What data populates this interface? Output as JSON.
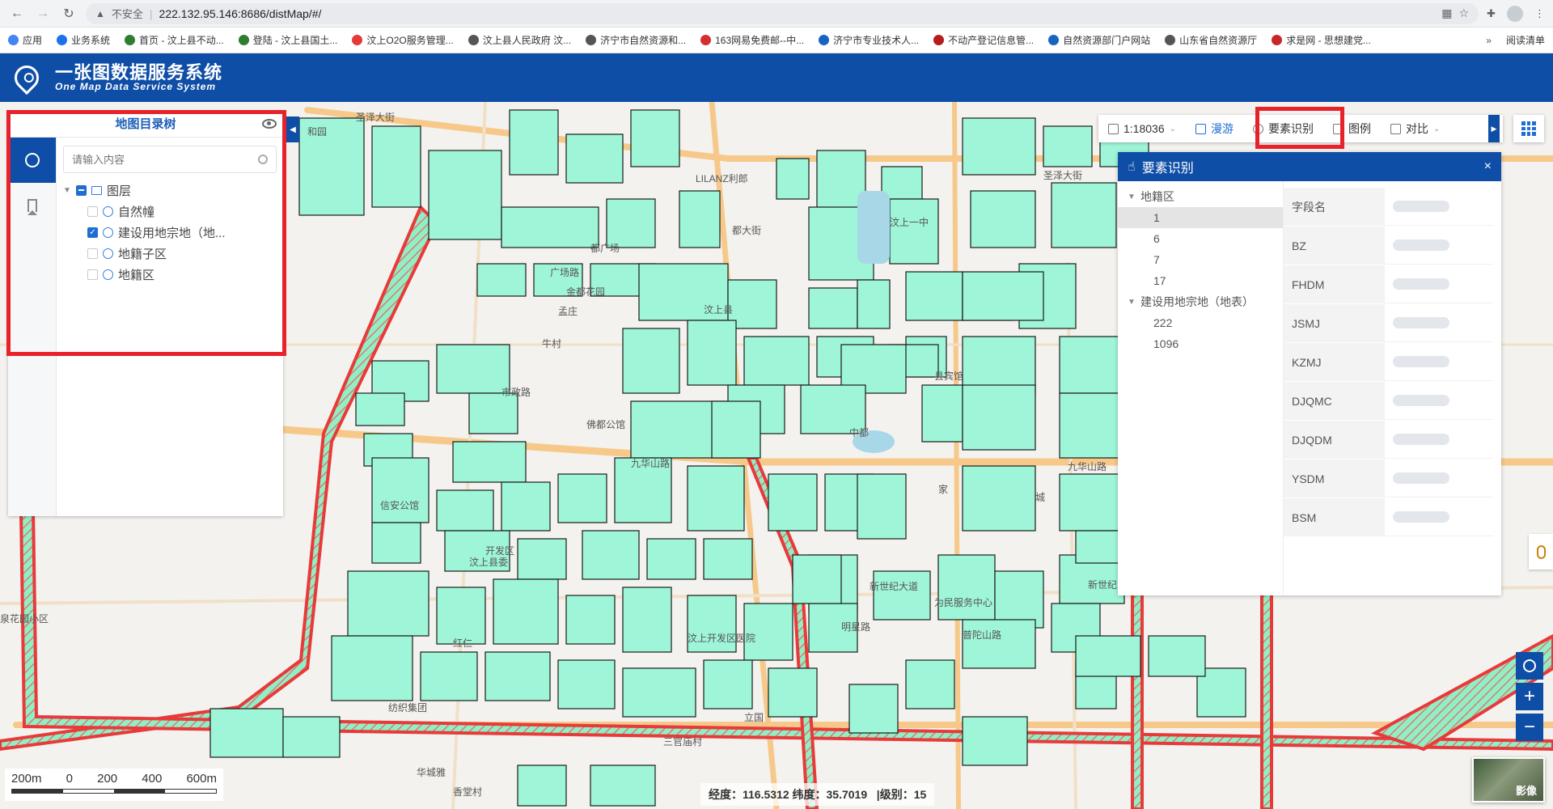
{
  "browser": {
    "insecure": "不安全",
    "url": "222.132.95.146:8686/distMap/#/",
    "bookmarks": [
      {
        "label": "应用",
        "color": "#4285f4"
      },
      {
        "label": "业务系统",
        "color": "#1a73e8"
      },
      {
        "label": "首页 - 汶上县不动...",
        "color": "#2e7d32"
      },
      {
        "label": "登陆 - 汶上县国土...",
        "color": "#2e7d32"
      },
      {
        "label": "汶上O2O服务管理...",
        "color": "#e53935"
      },
      {
        "label": "汶上县人民政府 汶...",
        "color": "#555555"
      },
      {
        "label": "济宁市自然资源和...",
        "color": "#555555"
      },
      {
        "label": "163网易免费邮--中...",
        "color": "#d32f2f"
      },
      {
        "label": "济宁市专业技术人...",
        "color": "#1565c0"
      },
      {
        "label": "不动产登记信息管...",
        "color": "#b71c1c"
      },
      {
        "label": "自然资源部门户网站",
        "color": "#1565c0"
      },
      {
        "label": "山东省自然资源厅",
        "color": "#555555"
      },
      {
        "label": "求是网 - 思想建党...",
        "color": "#c62828"
      }
    ],
    "more": "»",
    "reading_list": "阅读清单"
  },
  "header": {
    "title": "一张图数据服务系统",
    "subtitle": "One Map Data Service System"
  },
  "catalog": {
    "title": "地图目录树",
    "search_placeholder": "请输入内容",
    "root": "图层",
    "layers": [
      {
        "label": "自然幢",
        "checked": false
      },
      {
        "label": "建设用地宗地（地...",
        "checked": true
      },
      {
        "label": "地籍子区",
        "checked": false
      },
      {
        "label": "地籍区",
        "checked": false
      }
    ]
  },
  "toolbar": {
    "scale": "1:18036",
    "pan": "漫游",
    "identify": "要素识别",
    "legend": "图例",
    "compare": "对比"
  },
  "identify_panel": {
    "title": "要素识别",
    "close": "×",
    "groups": [
      {
        "label": "地籍区",
        "items": [
          "1",
          "6",
          "7",
          "17"
        ]
      },
      {
        "label": "建设用地宗地（地表）",
        "items": [
          "222",
          "1096"
        ]
      }
    ],
    "fields": [
      "字段名",
      "BZ",
      "FHDM",
      "JSMJ",
      "KZMJ",
      "DJQMC",
      "DJQDM",
      "YSDM",
      "BSM"
    ]
  },
  "scale_bar": [
    "200m",
    "0",
    "200",
    "400",
    "600m"
  ],
  "coords": {
    "lon_label": "经度：",
    "lon": "116.5312",
    "lat_label": "纬度：",
    "lat": "35.7019",
    "level_label": "|级别：",
    "level": "15"
  },
  "basemap": "影像",
  "map_labels": [
    "圣泽大街",
    "LILANZ利郎",
    "圣泽大街",
    "汶上一中",
    "广场路",
    "金都花园",
    "孟庄",
    "都广场",
    "都大街",
    "汶上县",
    "牛村",
    "市政路",
    "佛都公馆",
    "九华山路",
    "九华山路",
    "中都",
    "县宾馆",
    "开发区",
    "新世纪大道",
    "为民服务中心",
    "普陀山路",
    "明星路",
    "纺织集团",
    "三官庙村",
    "华城雅",
    "香堂村",
    "汶上开发区医院",
    "立国",
    "新世纪",
    "泉花园小区",
    "和园",
    "家",
    "城",
    "汶上县委",
    "红仁",
    "信安公馆"
  ],
  "colors": {
    "header": "#0f4ea6",
    "parcel_fill": "#9ff5d8",
    "boundary": "#e83a3a",
    "highlight_frame": "#e8222a",
    "road": "#f6c98a"
  }
}
